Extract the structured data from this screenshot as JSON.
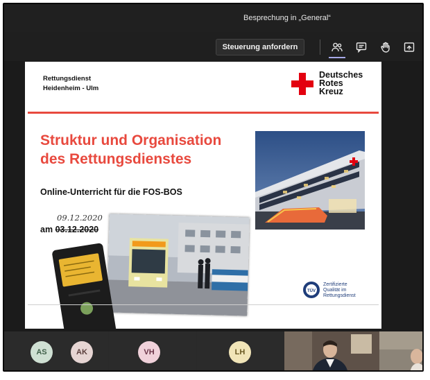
{
  "window": {
    "meeting_title": "Besprechung in „General“"
  },
  "toolbar": {
    "request_control_label": "Steuerung anfordern",
    "icons": [
      "participants-icon",
      "chat-icon",
      "raise-hand-icon",
      "share-tray-icon"
    ]
  },
  "slide": {
    "org_line1": "Rettungsdienst",
    "org_line2": "Heidenheim - Ulm",
    "logo_line1": "Deutsches",
    "logo_line2": "Rotes",
    "logo_line3": "Kreuz",
    "title_line1": "Struktur und Organisation",
    "title_line2": "des Rettungsdienstes",
    "subtitle": "Online-Unterricht für die FOS-BOS",
    "date_handwritten": "09.12.2020",
    "date_prefix": "am",
    "date_original": "03.12.2020",
    "cert_line1": "Zertifizierte",
    "cert_line2": "Qualität im",
    "cert_line3": "Rettungsdienst",
    "cert_logo_text": "TÜV"
  },
  "participants": [
    {
      "initials": "AS",
      "bg": "#cfe0d3",
      "fg": "#3f5f49"
    },
    {
      "initials": "AK",
      "bg": "#e6d5d3",
      "fg": "#5a3e3c"
    },
    {
      "initials": "VH",
      "bg": "#f0d1da",
      "fg": "#6a3448"
    },
    {
      "initials": "LH",
      "bg": "#f1e5b8",
      "fg": "#6a5a22"
    }
  ],
  "colors": {
    "accent_red": "#e8493e",
    "drk_red": "#e3000f",
    "teams_purple": "#a7a9e8"
  }
}
